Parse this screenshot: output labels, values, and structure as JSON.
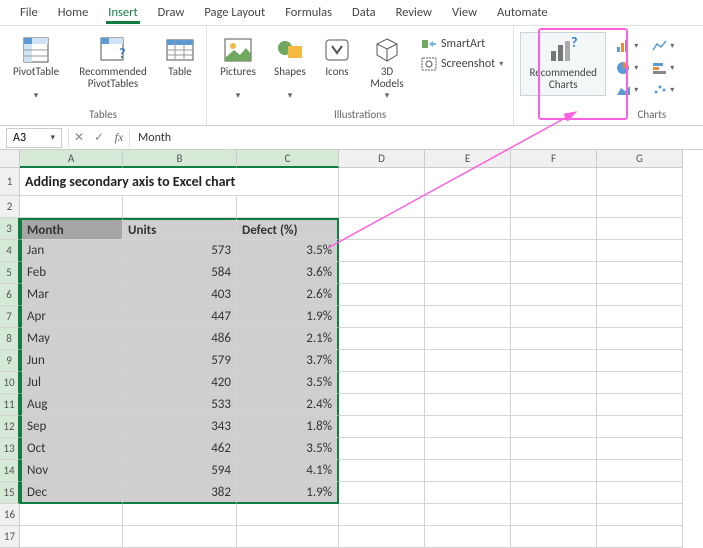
{
  "menu": [
    "File",
    "Home",
    "Insert",
    "Draw",
    "Page Layout",
    "Formulas",
    "Data",
    "Review",
    "View",
    "Automate"
  ],
  "menu_active_index": 2,
  "ribbon": {
    "tables": {
      "pivot": "PivotTable",
      "recpivot": "Recommended\nPivotTables",
      "table": "Table",
      "group": "Tables"
    },
    "illus": {
      "pictures": "Pictures",
      "shapes": "Shapes",
      "icons": "Icons",
      "models": "3D\nModels",
      "smartart": "SmartArt",
      "screenshot": "Screenshot",
      "group": "Illustrations"
    },
    "charts": {
      "rec": "Recommended\nCharts",
      "group": "Charts"
    }
  },
  "formula_bar": {
    "reference": "A3",
    "value": "Month"
  },
  "grid": {
    "cols": [
      "A",
      "B",
      "C",
      "D",
      "E",
      "F",
      "G"
    ],
    "title": "Adding secondary axis to Excel chart",
    "headers": [
      "Month",
      "Units",
      "Defect (%)"
    ],
    "rows": [
      [
        "Jan",
        "573",
        "3.5%"
      ],
      [
        "Feb",
        "584",
        "3.6%"
      ],
      [
        "Mar",
        "403",
        "2.6%"
      ],
      [
        "Apr",
        "447",
        "1.9%"
      ],
      [
        "May",
        "486",
        "2.1%"
      ],
      [
        "Jun",
        "579",
        "3.7%"
      ],
      [
        "Jul",
        "420",
        "3.5%"
      ],
      [
        "Aug",
        "533",
        "2.4%"
      ],
      [
        "Sep",
        "343",
        "1.8%"
      ],
      [
        "Oct",
        "462",
        "3.5%"
      ],
      [
        "Nov",
        "594",
        "4.1%"
      ],
      [
        "Dec",
        "382",
        "1.9%"
      ]
    ]
  }
}
